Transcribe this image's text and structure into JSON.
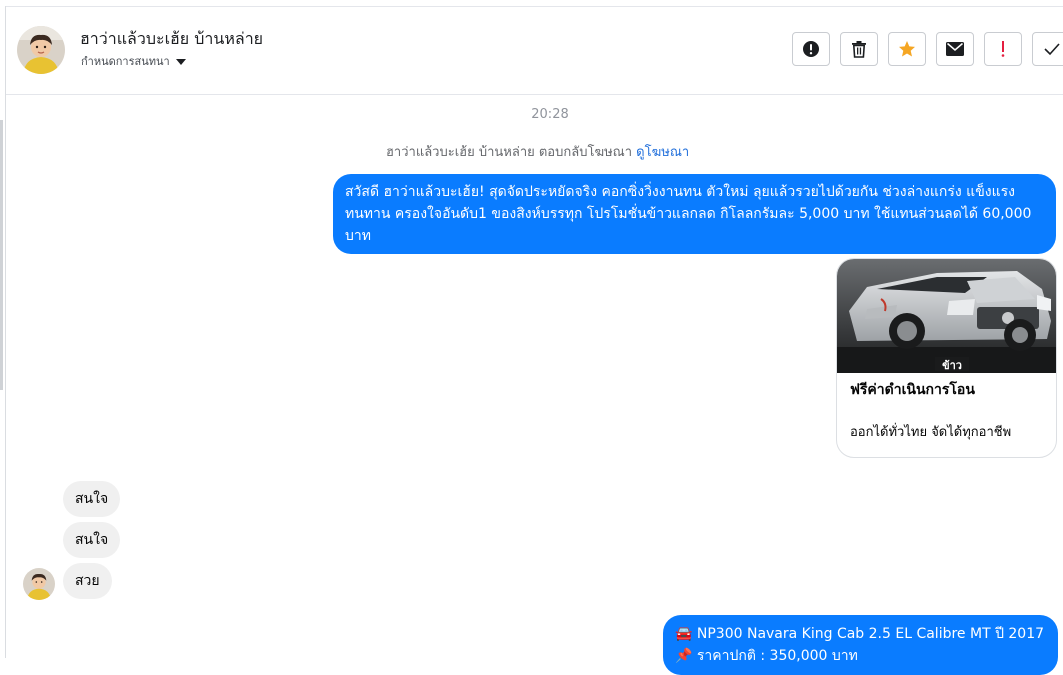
{
  "header": {
    "contact_name": "ฮาว่าแล้วบะเฮ้ย บ้านหล่าย",
    "tag_label": "กำหนดการสนทนา",
    "toolbar": {
      "spam_icon": "alert-circle-icon",
      "delete_icon": "trash-icon",
      "star_icon": "star-icon",
      "star_color": "#f5a623",
      "mail_icon": "envelope-icon",
      "important_icon": "exclamation-icon",
      "important_color": "#e41e3f",
      "done_icon": "check-icon"
    }
  },
  "conversation": {
    "timestamp": "20:28",
    "ad_reply_text": "ฮาว่าแล้วบะเฮ้ย บ้านหล่าย ตอบกลับโฆษณา",
    "ad_reply_link": "ดูโฆษณา",
    "outgoing_message": "สวัสดี ฮาว่าแล้วบะเฮ้ย! สุดจัดประหยัดจริง คอกซิ่งวิ่งงานทน ตัวใหม่ ลุยแล้วรวยไปด้วยกัน ช่วงล่างแกร่ง แข็งแรงทนทาน ครองใจอันดับ1 ของสิงห์บรรทุก โปรโมชั่นข้าวแลกลด กิโลลกรัมละ 5,000 บาท ใช้แทนส่วนลดได้ 60,000 บาท",
    "ad_card": {
      "image_label": "ข้าว",
      "title": "ฟรีค่าดำเนินการโอน",
      "subtitle": "ออกได้ทั่วไทย จัดได้ทุกอาชีพ"
    },
    "incoming_messages": [
      "สนใจ",
      "สนใจ",
      "สวย"
    ],
    "last_outgoing_line1": "🚘 NP300 Navara King Cab 2.5 EL Calibre MT ปี 2017",
    "last_outgoing_line2": "📌 ราคาปกติ : 350,000 บาท",
    "accent_color": "#0a7cff"
  }
}
